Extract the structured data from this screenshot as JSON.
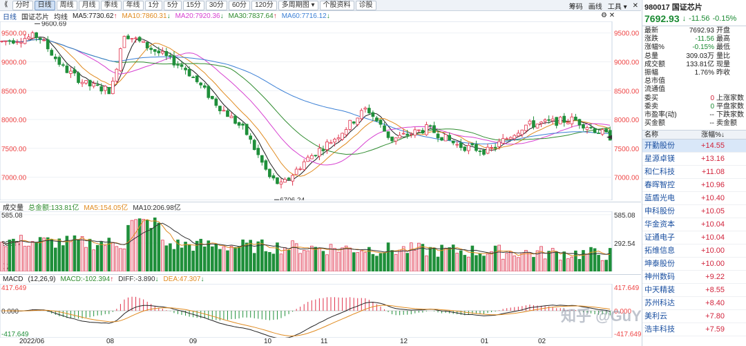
{
  "toolbar": {
    "items": [
      "分时",
      "日线",
      "周线",
      "月线",
      "季线",
      "年线",
      "1分",
      "5分",
      "15分",
      "30分",
      "60分",
      "120分",
      "多周期图 ▾",
      "个股资料",
      "诊股"
    ],
    "active": "日线",
    "right": [
      "筹码",
      "画线",
      "工具 ▾",
      "✕"
    ]
  },
  "kline": {
    "label": "日线",
    "name": "国证芯片",
    "mode": "均线",
    "ma": [
      {
        "text": "MA5:7730.62",
        "arrow": "↑",
        "color": "#1a1a1a"
      },
      {
        "text": "MA10:7860.31",
        "arrow": "↓",
        "color": "#e08a1e"
      },
      {
        "text": "MA20:7920.36",
        "arrow": "↓",
        "color": "#d63fd0"
      },
      {
        "text": "MA30:7837.64",
        "arrow": "↑",
        "color": "#2e8b2e"
      },
      {
        "text": "MA60:7716.12",
        "arrow": "↓",
        "color": "#3a7fd5"
      }
    ],
    "yticks": [
      "9500.00",
      "9000.00",
      "8500.00",
      "8000.00",
      "7500.00",
      "7000.00"
    ],
    "high_label": "9600.69",
    "low_label": "6706.24"
  },
  "volume": {
    "label": "成交量",
    "total": "总金额:133.81亿",
    "ma5": "MA5:154.05亿",
    "ma10": "MA10:206.98亿",
    "yticks": [
      "585.08",
      "292.54"
    ],
    "unit": "亿"
  },
  "macd": {
    "label": "MACD",
    "params": "(12,26,9)",
    "macd": "MACD:-102.394",
    "macd_arrow": "↑",
    "diff": "DIFF:-3.890",
    "diff_arrow": "↓",
    "dea": "DEA:47.307",
    "dea_arrow": "↓",
    "yticks": [
      "417.649",
      "0.000",
      "-417.649"
    ]
  },
  "xaxis": [
    "2022/06",
    "08",
    "09",
    "10",
    "11",
    "12",
    "01",
    "02"
  ],
  "quote": {
    "code": "980017",
    "name": "国证芯片",
    "price": "7692.93",
    "arrow": "↓",
    "change": "-11.56",
    "pct": "-0.15%",
    "rows": [
      {
        "l": "最新",
        "v": "7692.93",
        "r": "开盘",
        "c": ""
      },
      {
        "l": "涨跌",
        "v": "-11.56",
        "r": "最高",
        "c": "green"
      },
      {
        "l": "涨幅%",
        "v": "-0.15%",
        "r": "最低",
        "c": "green"
      },
      {
        "l": "总量",
        "v": "309.03万",
        "r": "量比",
        "c": ""
      },
      {
        "l": "成交额",
        "v": "133.81亿",
        "r": "现量",
        "c": ""
      },
      {
        "l": "振幅",
        "v": "1.76%",
        "r": "昨收",
        "c": ""
      },
      {
        "l": "总市值",
        "v": "",
        "r": "",
        "c": ""
      },
      {
        "l": "流通值",
        "v": "",
        "r": "",
        "c": ""
      },
      {
        "l": "委买",
        "v": "0",
        "r": "上涨家数",
        "c": "red"
      },
      {
        "l": "委卖",
        "v": "0",
        "r": "平盘家数",
        "c": "green"
      },
      {
        "l": "市盈率(动)",
        "v": "--",
        "r": "下跌家数",
        "c": ""
      },
      {
        "l": "买金额",
        "v": "--",
        "r": "卖金额",
        "c": ""
      }
    ]
  },
  "rank": {
    "col_name": "名称",
    "col_val": "涨幅%↓",
    "rows": [
      {
        "n": "开勤股份",
        "v": "+14.55"
      },
      {
        "n": "星源卓镁",
        "v": "+13.16"
      },
      {
        "n": "和仁科技",
        "v": "+11.08"
      },
      {
        "n": "春晖智控",
        "v": "+10.96"
      },
      {
        "n": "蓝盾光电",
        "v": "+10.40"
      },
      {
        "n": "申科股份",
        "v": "+10.05"
      },
      {
        "n": "华金资本",
        "v": "+10.04"
      },
      {
        "n": "证通电子",
        "v": "+10.04"
      },
      {
        "n": "拓维信息",
        "v": "+10.00"
      },
      {
        "n": "坤泰股份",
        "v": "+10.00"
      },
      {
        "n": "神州数码",
        "v": "+9.22"
      },
      {
        "n": "中天精装",
        "v": "+8.55"
      },
      {
        "n": "苏州科达",
        "v": "+8.40"
      },
      {
        "n": "美利云",
        "v": "+7.80"
      },
      {
        "n": "浩丰科技",
        "v": "+7.59"
      }
    ]
  },
  "watermark": "知乎 @GuYingHu"
}
